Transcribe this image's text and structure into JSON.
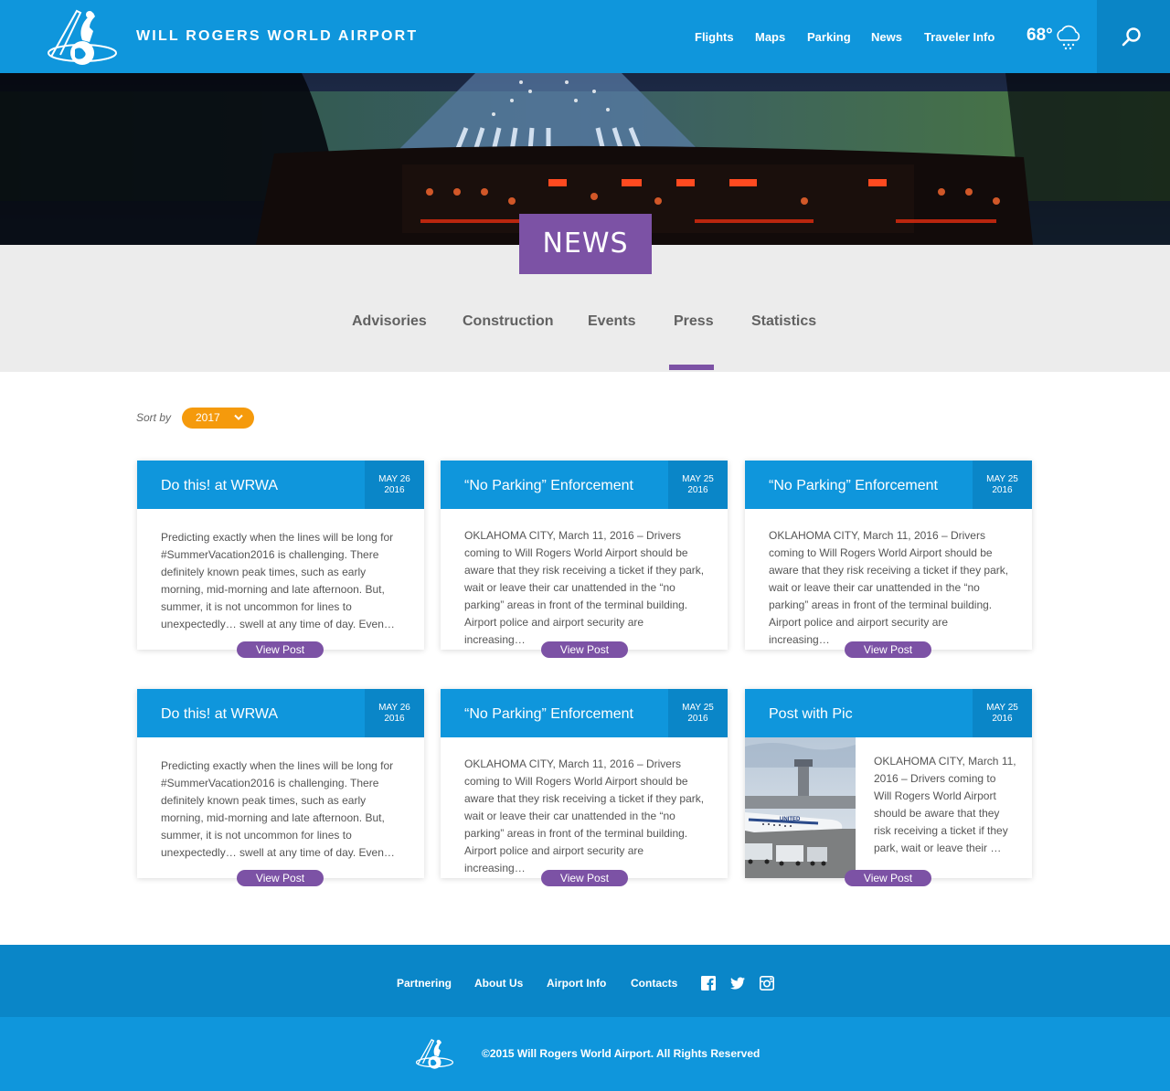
{
  "header": {
    "site_title": "WILL ROGERS WORLD AIRPORT",
    "nav": [
      "Flights",
      "Maps",
      "Parking",
      "News",
      "Traveler Info"
    ],
    "weather_temp": "68°",
    "weather_icon": "snow-cloud-icon"
  },
  "hero": {
    "badge": "NEWS"
  },
  "tabs": [
    "Advisories",
    "Construction",
    "Events",
    "Press",
    "Statistics"
  ],
  "active_tab": "Press",
  "sort": {
    "label": "Sort by",
    "value": "2017"
  },
  "cards": [
    {
      "title": "Do this! at WRWA",
      "date_md": "MAY 26",
      "date_y": "2016",
      "body": "Predicting exactly when the lines will be long for #SummerVacation2016 is challenging.  There definitely known peak times, such as early morning, mid-morning and late afternoon. But, summer, it is not uncommon for lines to unexpectedly… swell at any time of day.  Even…",
      "button": "View Post"
    },
    {
      "title": "“No Parking” Enforcement",
      "date_md": "MAY 25",
      "date_y": "2016",
      "body": "OKLAHOMA CITY, March 11, 2016 – Drivers coming to Will Rogers World Airport should be aware that they risk receiving a ticket if they park, wait or leave their car unattended in the “no parking” areas in front of the terminal building. Airport police and airport security are increasing…",
      "button": "View Post"
    },
    {
      "title": "“No Parking” Enforcement",
      "date_md": "MAY 25",
      "date_y": "2016",
      "body": "OKLAHOMA CITY, March 11, 2016 – Drivers coming to Will Rogers World Airport should be aware that they risk receiving a ticket if they park, wait or leave their car unattended in the “no parking” areas in front of the terminal building. Airport police and airport security are increasing…",
      "button": "View Post"
    },
    {
      "title": "Do this! at WRWA",
      "date_md": "MAY 26",
      "date_y": "2016",
      "body": "Predicting exactly when the lines will be long for #SummerVacation2016 is challenging.  There definitely known peak times, such as early morning, mid-morning and late afternoon. But, summer, it is not uncommon for lines to unexpectedly… swell at any time of day.  Even…",
      "button": "View Post"
    },
    {
      "title": "“No Parking” Enforcement",
      "date_md": "MAY 25",
      "date_y": "2016",
      "body": "OKLAHOMA CITY, March 11, 2016 – Drivers coming to Will Rogers World Airport should be aware that they risk receiving a ticket if they park, wait or leave their car unattended in the “no parking” areas in front of the terminal building. Airport police and airport security are increasing…",
      "button": "View Post"
    },
    {
      "title": "Post with Pic",
      "date_md": "MAY 25",
      "date_y": "2016",
      "body": "OKLAHOMA CITY, March 11, 2016 – Drivers coming to Will Rogers World Airport should be aware that they risk receiving a ticket if they park, wait or leave their …",
      "button": "View Post"
    }
  ],
  "footer": {
    "links": [
      "Partnering",
      "About Us",
      "Airport Info",
      "Contacts"
    ],
    "social": [
      "facebook-icon",
      "twitter-icon",
      "instagram-icon"
    ],
    "copyright": "©2015 Will Rogers World Airport. All Rights Reserved"
  },
  "colors": {
    "brand_blue": "#0f96dc",
    "dark_blue": "#0a86c8",
    "purple": "#7c52a5",
    "orange": "#f59a0c"
  }
}
